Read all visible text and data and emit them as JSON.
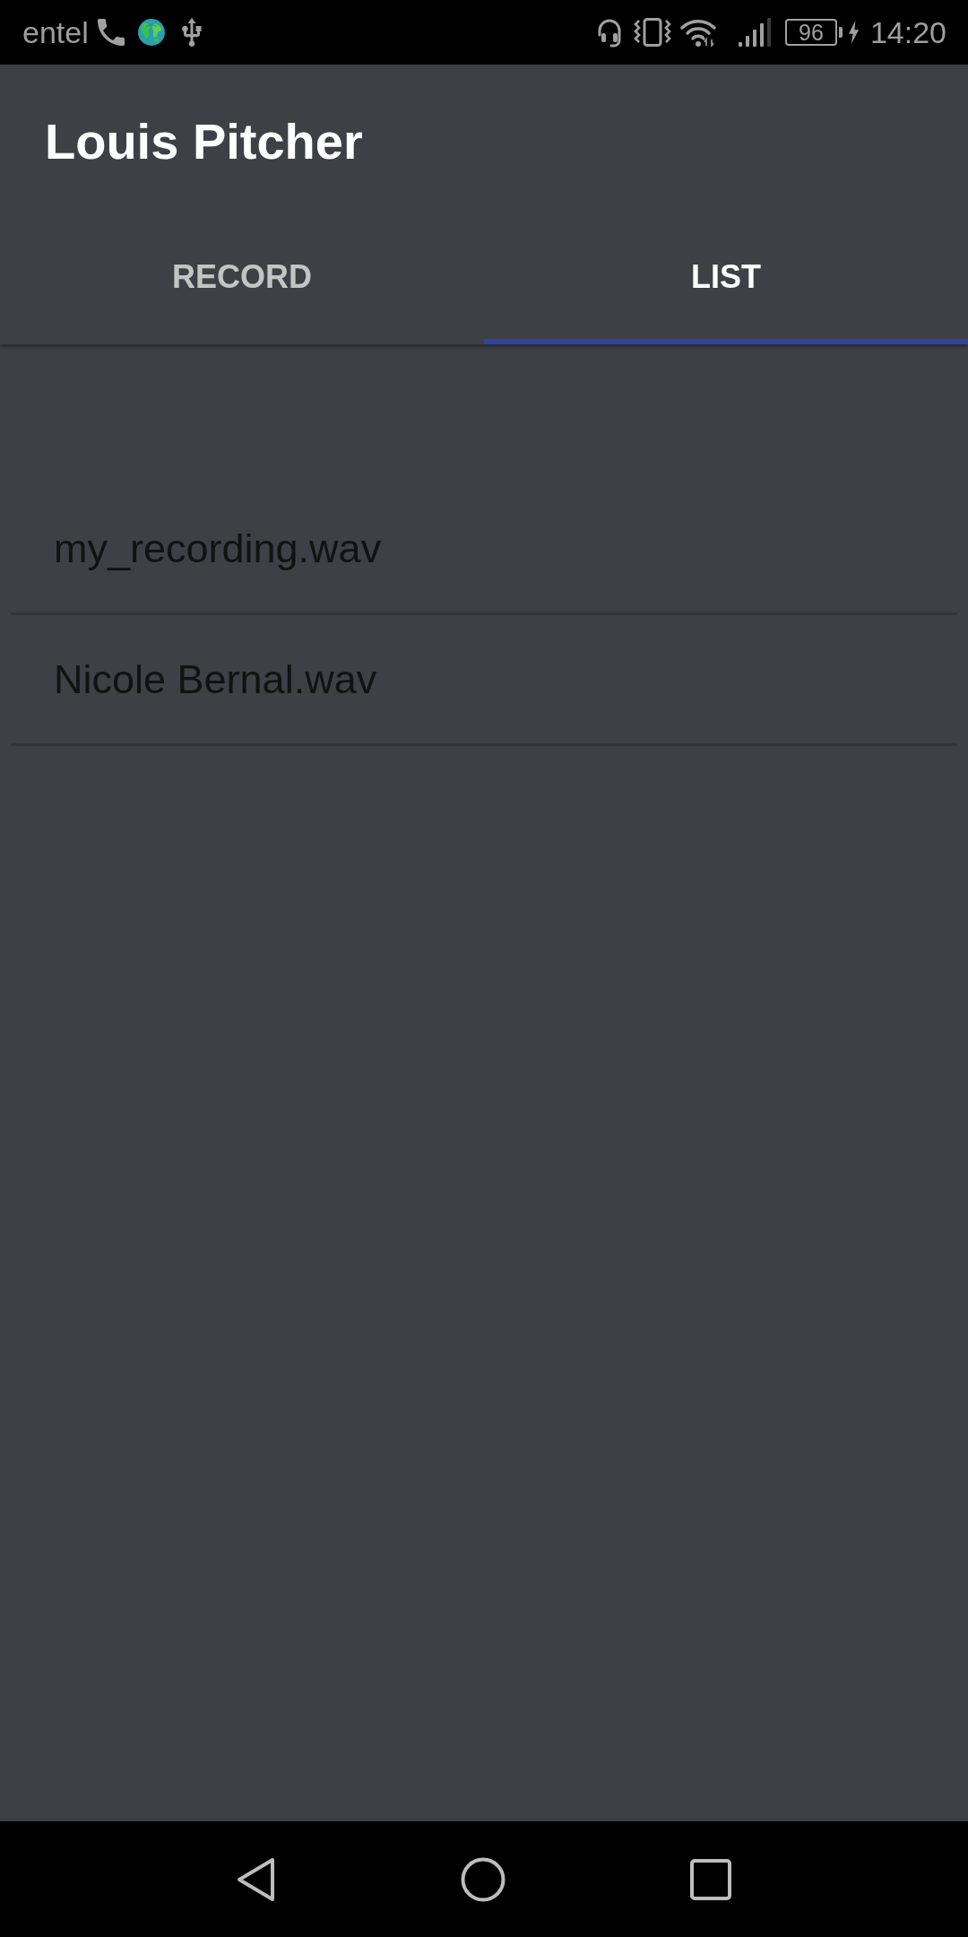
{
  "status_bar": {
    "carrier": "entel",
    "battery": "96",
    "time": "14:20"
  },
  "app_bar": {
    "title": "Louis Pitcher"
  },
  "tabs": [
    {
      "label": "RECORD",
      "selected": false
    },
    {
      "label": "LIST",
      "selected": true
    }
  ],
  "recordings": [
    {
      "name": "my_recording.wav"
    },
    {
      "name": "Nicole Bernal.wav"
    }
  ]
}
